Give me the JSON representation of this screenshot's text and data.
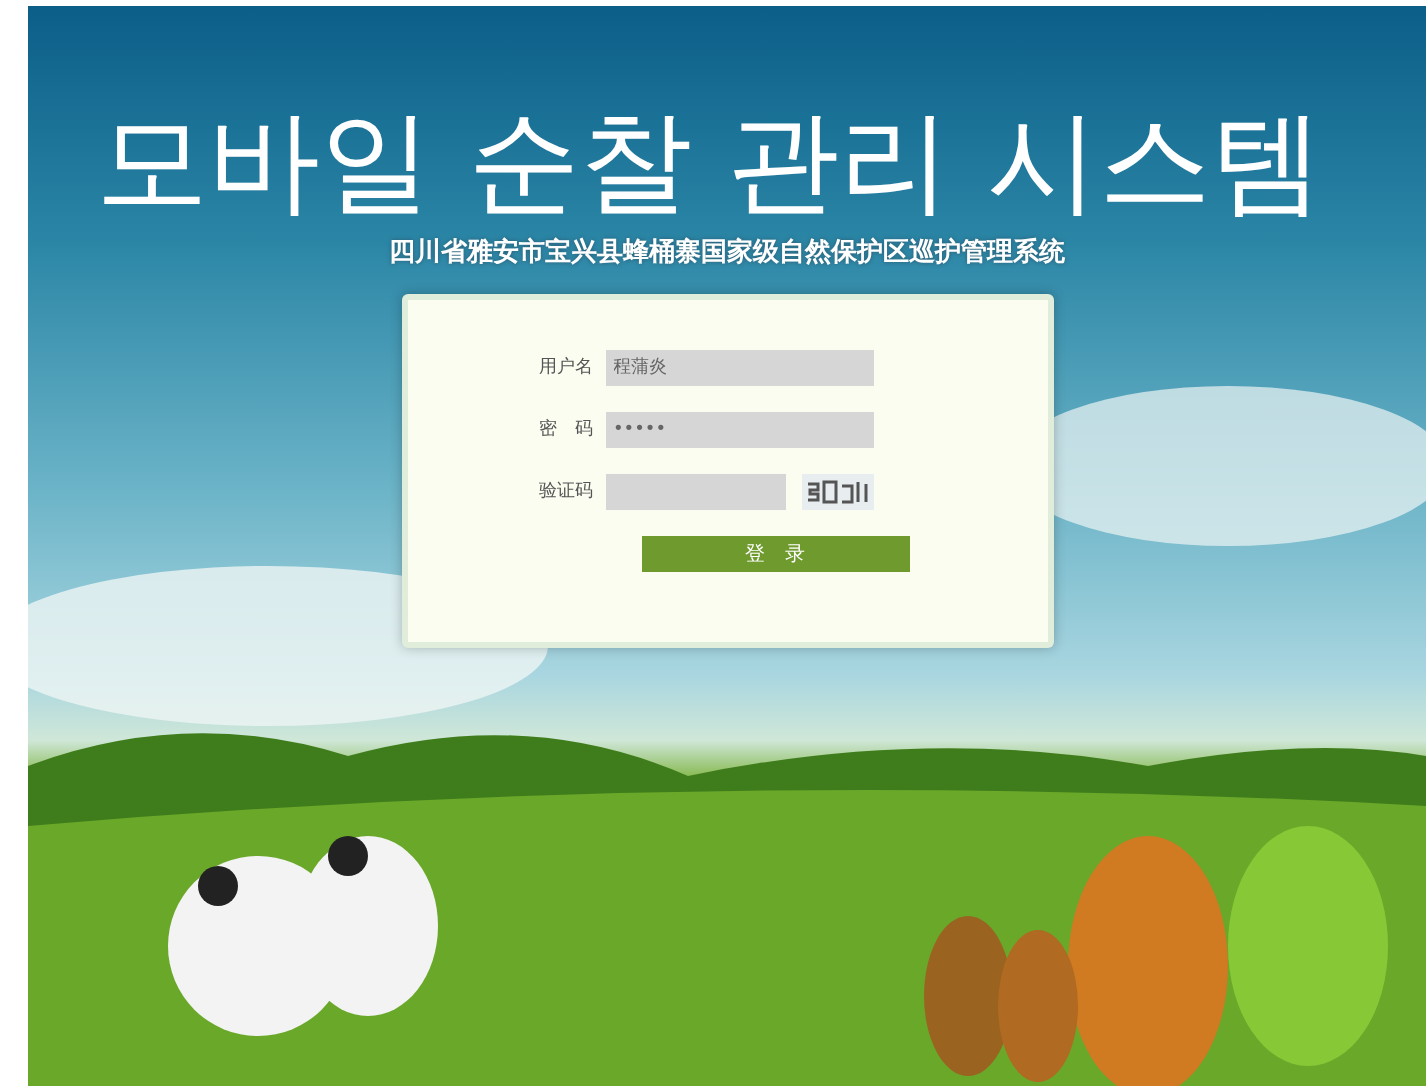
{
  "slide_title": "모바일 순찰 관리 시스템",
  "system_title": "四川省雅安市宝兴县蜂桶寨国家级自然保护区巡护管理系统",
  "login": {
    "fields": [
      {
        "kind": "text",
        "label": "用户名",
        "value": "程蒲炎"
      },
      {
        "kind": "password",
        "label": "密　码",
        "value": "•••••"
      },
      {
        "kind": "captcha",
        "label": "验证码"
      }
    ],
    "button": "登　录"
  }
}
